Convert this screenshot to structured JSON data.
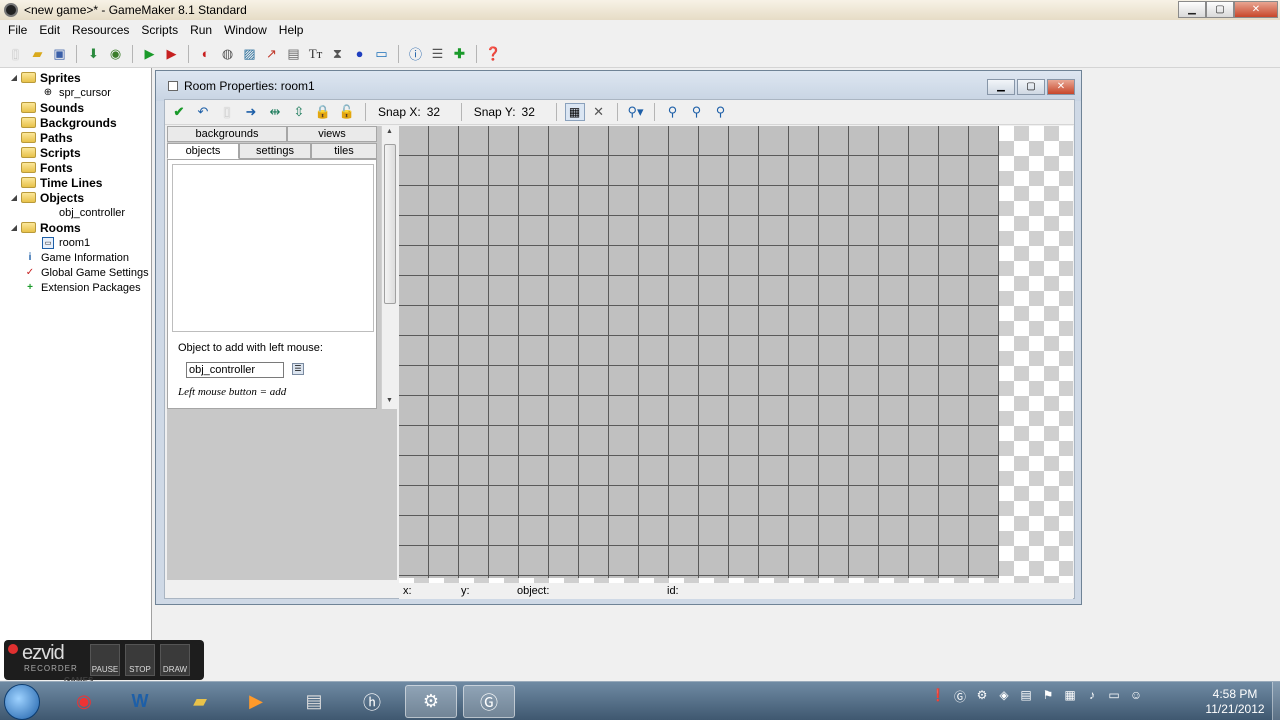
{
  "window": {
    "title": "<new game>* - GameMaker 8.1 Standard",
    "min_label": "▁",
    "max_label": "▢",
    "close_label": "✕"
  },
  "menu": [
    "File",
    "Edit",
    "Resources",
    "Scripts",
    "Run",
    "Window",
    "Help"
  ],
  "tree": {
    "sprites": "Sprites",
    "spr_cursor": "spr_cursor",
    "sounds": "Sounds",
    "backgrounds": "Backgrounds",
    "paths": "Paths",
    "scripts": "Scripts",
    "fonts": "Fonts",
    "time_lines": "Time Lines",
    "objects": "Objects",
    "obj_controller": "obj_controller",
    "rooms": "Rooms",
    "room1": "room1",
    "game_information": "Game Information",
    "global_game_settings": "Global Game Settings",
    "extension_packages": "Extension Packages"
  },
  "room": {
    "title": "Room Properties: room1",
    "snap_x_label": "Snap X:",
    "snap_x_value": "32",
    "snap_y_label": "Snap Y:",
    "snap_y_value": "32",
    "tabs_top": [
      "backgrounds",
      "views"
    ],
    "tabs_bottom": [
      "objects",
      "settings",
      "tiles"
    ],
    "object_add_label": "Object to add with left mouse:",
    "object_selected": "obj_controller",
    "hint": "Left mouse button = add",
    "status": {
      "x": "x:",
      "y": "y:",
      "object": "object:",
      "id": "id:"
    }
  },
  "ezvid": {
    "logo": "ezvid",
    "sub": "RECORDER",
    "games": "GAMES",
    "pause": "PAUSE",
    "stop": "STOP",
    "draw": "DRAW"
  },
  "clock": {
    "time": "4:58 PM",
    "date": "11/21/2012"
  },
  "colors": {
    "accent": "#3f5870",
    "grid_line": "#5a5a5a",
    "room_bg": "#c0c0c0"
  }
}
